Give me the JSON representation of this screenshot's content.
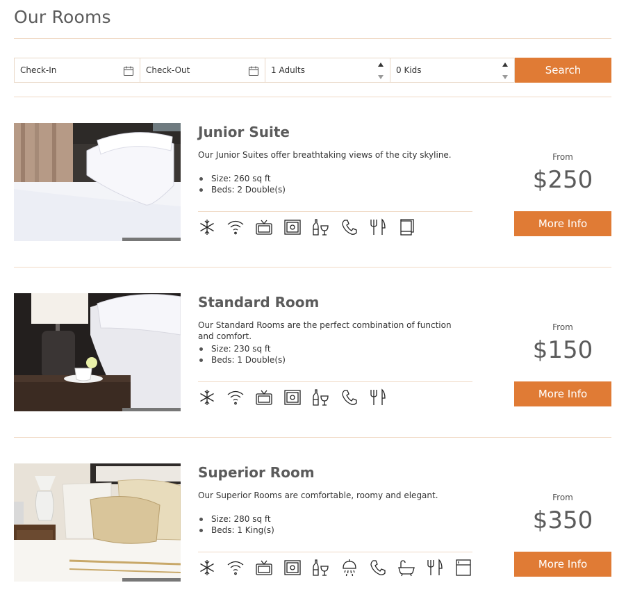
{
  "page": {
    "title": "Our Rooms"
  },
  "search": {
    "checkin_placeholder": "Check-In",
    "checkout_placeholder": "Check-Out",
    "adults_value": "1 Adults",
    "kids_value": "0 Kids",
    "button_label": "Search"
  },
  "colors": {
    "accent": "#e07b35",
    "divider": "#f0d9c4",
    "heading": "#5b5b5b"
  },
  "rooms": [
    {
      "title": "Junior Suite",
      "description": "Our Junior Suites offer breathtaking views of the city skyline.",
      "specs": [
        "Size: 260 sq ft",
        "Beds: 2 Double(s)"
      ],
      "from_label": "From",
      "price": "$250",
      "button_label": "More Info",
      "amenities": [
        "air-conditioning-icon",
        "wifi-icon",
        "tv-icon",
        "safe-icon",
        "minibar-icon",
        "phone-icon",
        "restaurant-icon",
        "towels-icon"
      ]
    },
    {
      "title": "Standard Room",
      "description": "Our Standard Rooms are the perfect combination of function and comfort.",
      "specs": [
        "Size: 230 sq ft",
        "Beds: 1 Double(s)"
      ],
      "from_label": "From",
      "price": "$150",
      "button_label": "More Info",
      "amenities": [
        "air-conditioning-icon",
        "wifi-icon",
        "tv-icon",
        "safe-icon",
        "minibar-icon",
        "phone-icon",
        "restaurant-icon"
      ]
    },
    {
      "title": "Superior Room",
      "description": "Our Superior Rooms are comfortable, roomy and elegant.",
      "specs": [
        "Size: 280 sq ft",
        "Beds: 1 King(s)"
      ],
      "from_label": "From",
      "price": "$350",
      "button_label": "More Info",
      "amenities": [
        "air-conditioning-icon",
        "wifi-icon",
        "tv-icon",
        "safe-icon",
        "minibar-icon",
        "shower-icon",
        "phone-icon",
        "bathtub-icon",
        "restaurant-icon",
        "fridge-icon"
      ]
    }
  ]
}
